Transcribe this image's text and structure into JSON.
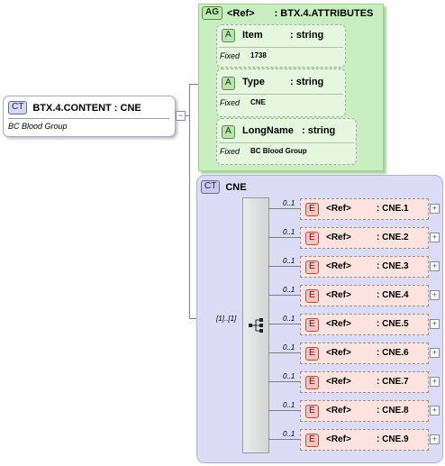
{
  "root": {
    "badge": "CT",
    "title": "BTX.4.CONTENT : CNE",
    "description": "BC Blood Group",
    "toggle": "−"
  },
  "attribute_group": {
    "badge": "AG",
    "ref": "<Ref>",
    "name": ": BTX.4.ATTRIBUTES",
    "attributes": [
      {
        "badge": "A",
        "name": "Item",
        "type": ": string",
        "fixed_label": "Fixed",
        "fixed_value": "1738"
      },
      {
        "badge": "A",
        "name": "Type",
        "type": ": string",
        "fixed_label": "Fixed",
        "fixed_value": "CNE"
      },
      {
        "badge": "A",
        "name": "LongName",
        "type": ": string",
        "fixed_label": "Fixed",
        "fixed_value": "BC Blood Group"
      }
    ]
  },
  "cne": {
    "badge": "CT",
    "title": "CNE",
    "sequence_occurrence": "[1]..[1]",
    "elements": [
      {
        "occ": "0..1",
        "badge": "E",
        "ref": "<Ref>",
        "name": ": CNE.1",
        "toggle": "+"
      },
      {
        "occ": "0..1",
        "badge": "E",
        "ref": "<Ref>",
        "name": ": CNE.2",
        "toggle": "+"
      },
      {
        "occ": "0..1",
        "badge": "E",
        "ref": "<Ref>",
        "name": ": CNE.3",
        "toggle": "+"
      },
      {
        "occ": "0..1",
        "badge": "E",
        "ref": "<Ref>",
        "name": ": CNE.4",
        "toggle": "+"
      },
      {
        "occ": "0..1",
        "badge": "E",
        "ref": "<Ref>",
        "name": ": CNE.5",
        "toggle": "+"
      },
      {
        "occ": "0..1",
        "badge": "E",
        "ref": "<Ref>",
        "name": ": CNE.6",
        "toggle": "+"
      },
      {
        "occ": "0..1",
        "badge": "E",
        "ref": "<Ref>",
        "name": ": CNE.7",
        "toggle": "+"
      },
      {
        "occ": "0..1",
        "badge": "E",
        "ref": "<Ref>",
        "name": ": CNE.8",
        "toggle": "+"
      },
      {
        "occ": "0..1",
        "badge": "E",
        "ref": "<Ref>",
        "name": ": CNE.9",
        "toggle": "+"
      }
    ]
  }
}
